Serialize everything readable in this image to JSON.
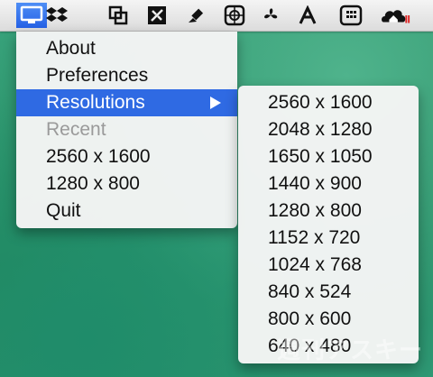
{
  "menubar": {
    "icons": [
      "display-icon",
      "dropbox-icon",
      "window-resize-icon",
      "tool-icon",
      "pen-icon",
      "crosshair-icon",
      "fan-icon",
      "font-icon",
      "grid-icon",
      "cloud-home-icon"
    ]
  },
  "main_menu": {
    "items": [
      {
        "label": "About",
        "state": "normal"
      },
      {
        "label": "Preferences",
        "state": "normal"
      },
      {
        "label": "Resolutions",
        "state": "highlighted"
      },
      {
        "label": "Recent",
        "state": "disabled"
      },
      {
        "label": "2560 x 1600",
        "state": "normal"
      },
      {
        "label": "1280 x 800",
        "state": "normal"
      },
      {
        "label": "Quit",
        "state": "normal"
      }
    ]
  },
  "submenu": {
    "items": [
      "2560 x 1600",
      "2048 x 1280",
      "1650 x 1050",
      "1440 x 900",
      "1280 x 800",
      "1152 x 720",
      "1024 x 768",
      "840 x 524",
      "800 x 600",
      "640 x 480"
    ]
  },
  "watermark": "週刊アスキー",
  "colors": {
    "highlight": "#2f6ae3",
    "menubar_active": "#2e6ae6",
    "desktop": "#2e9874"
  }
}
